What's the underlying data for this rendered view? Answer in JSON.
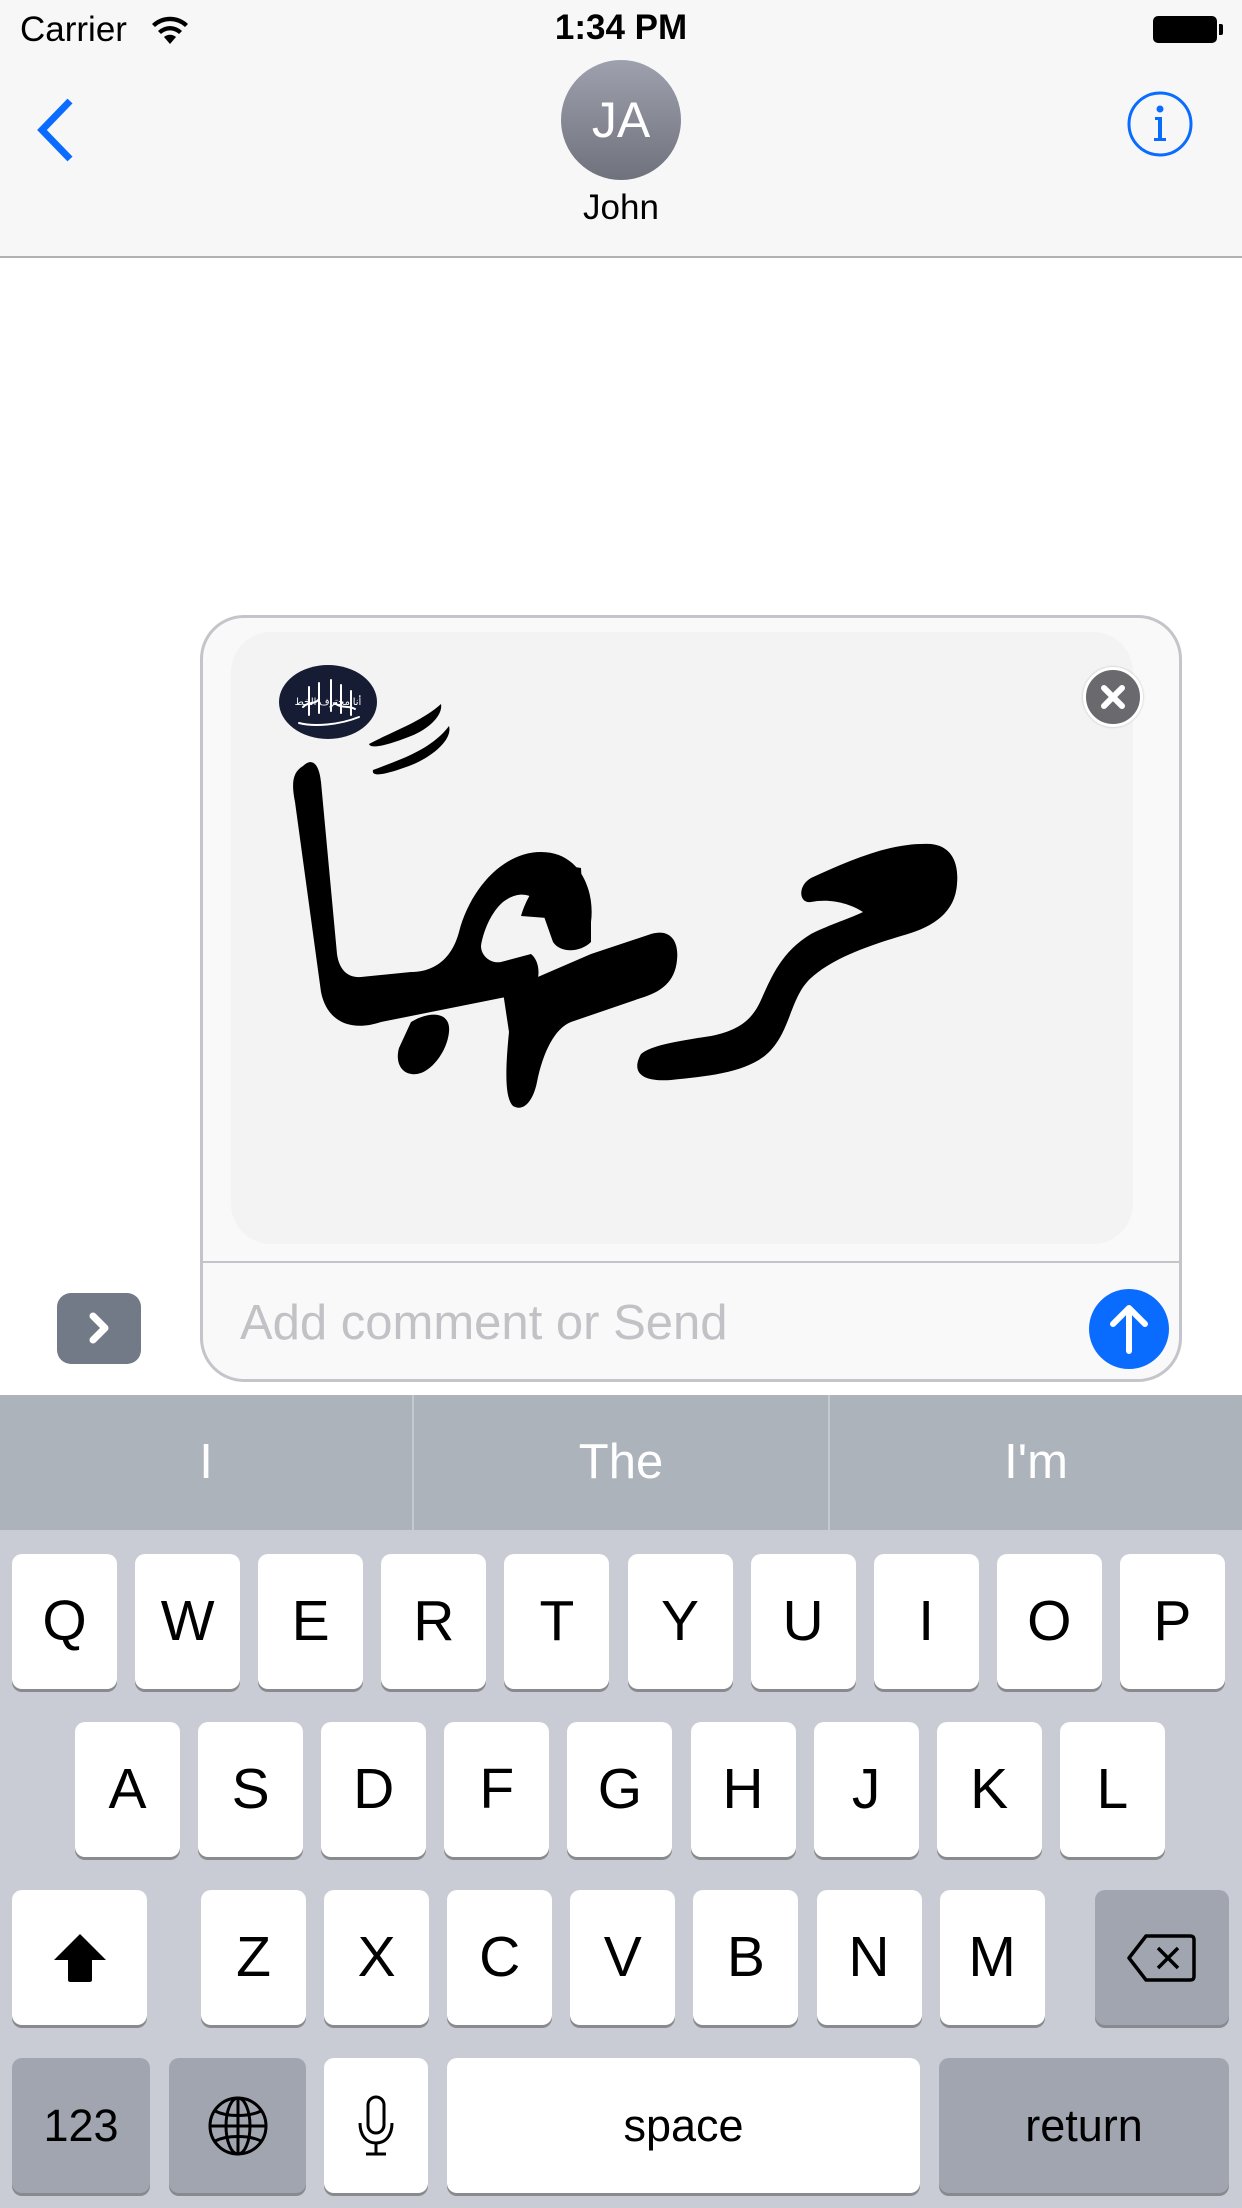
{
  "status_bar": {
    "carrier": "Carrier",
    "time": "1:34 PM",
    "wifi_icon": "wifi-icon",
    "battery_icon": "battery-icon"
  },
  "nav": {
    "back_icon": "chevron-left-icon",
    "contact_initials": "JA",
    "contact_name": "John",
    "info_icon": "info-circle-icon"
  },
  "colors": {
    "accent": "#0a6cff",
    "nav_bg": "#f7f7f7",
    "keyboard_bg": "#c9ccd4",
    "suggestion_bg": "#adb3bb",
    "dark_key": "#a0a5b0"
  },
  "compose": {
    "expand_icon": "chevron-right-icon",
    "sticker_text": "مرحباً",
    "sticker_logo_text": "أنا محترف الخط",
    "close_icon": "close-x-icon",
    "comment_placeholder": "Add comment or Send",
    "comment_value": "",
    "send_icon": "arrow-up-icon"
  },
  "keyboard": {
    "suggestions": [
      "I",
      "The",
      "I'm"
    ],
    "row1": [
      "Q",
      "W",
      "E",
      "R",
      "T",
      "Y",
      "U",
      "I",
      "O",
      "P"
    ],
    "row2": [
      "A",
      "S",
      "D",
      "F",
      "G",
      "H",
      "J",
      "K",
      "L"
    ],
    "row3": [
      "Z",
      "X",
      "C",
      "V",
      "B",
      "N",
      "M"
    ],
    "shift_icon": "shift-arrow-icon",
    "delete_icon": "backspace-icon",
    "numbers_label": "123",
    "globe_icon": "globe-icon",
    "mic_icon": "microphone-icon",
    "space_label": "space",
    "return_label": "return"
  }
}
